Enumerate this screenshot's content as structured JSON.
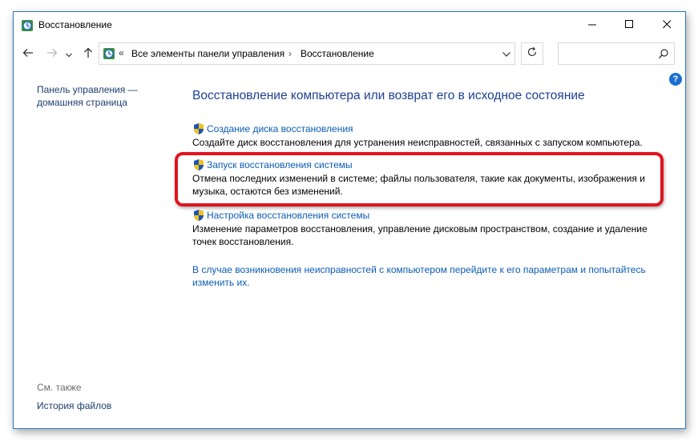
{
  "window": {
    "title": "Восстановление",
    "title_icon": "control-panel-icon",
    "controls": [
      "minimize-icon",
      "maximize-icon",
      "close-icon"
    ]
  },
  "nav": {
    "back_icon": "arrow-left-icon",
    "forward_icon": "arrow-right-icon",
    "recent_icon": "chevron-down-icon",
    "up_icon": "arrow-up-icon"
  },
  "address": {
    "overflow": "«",
    "breadcrumbs": [
      "Все элементы панели управления",
      "Восстановление"
    ],
    "separator": "›",
    "dropdown_icon": "chevron-down-icon",
    "refresh_icon": "refresh-icon"
  },
  "search": {
    "value": "",
    "icon": "search-icon"
  },
  "help": {
    "label": "?"
  },
  "left_pane": {
    "home_link": "Панель управления — домашняя страница",
    "see_also_label": "См. также",
    "see_also_links": [
      "История файлов"
    ]
  },
  "main": {
    "title": "Восстановление компьютера или возврат его в исходное состояние",
    "items": [
      {
        "icon": "uac-shield-icon",
        "link": "Создание диска восстановления",
        "description": "Создайте диск восстановления для устранения неисправностей, связанных с запуском компьютера."
      },
      {
        "icon": "uac-shield-icon",
        "link": "Запуск восстановления системы",
        "description": "Отмена последних изменений в системе; файлы пользователя, такие как документы, изображения и музыка, остаются без изменений."
      },
      {
        "icon": "uac-shield-icon",
        "link": "Настройка восстановления системы",
        "description": "Изменение параметров восстановления, управление дисковым пространством, создание и удаление точек восстановления."
      }
    ],
    "bottom_link": "В случае возникновения неисправностей с компьютером перейдите к его параметрам и попытайтесь изменить их."
  },
  "colors": {
    "accent_border": "#2b78c6",
    "link": "#0b5cb5",
    "title": "#1e3f94",
    "highlight": "#e0141e"
  }
}
